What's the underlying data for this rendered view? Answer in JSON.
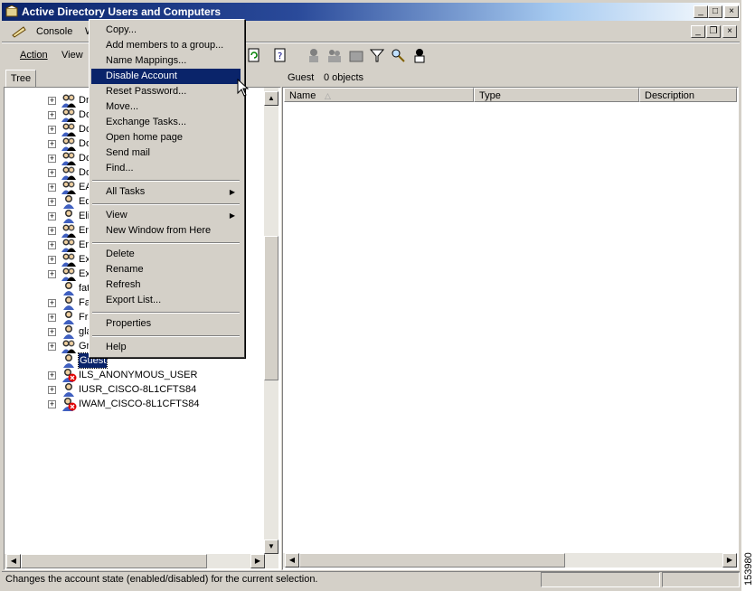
{
  "window": {
    "title": "Active Directory Users and Computers",
    "caption_buttons": {
      "minimize": "_",
      "maximize": "□",
      "close": "×"
    },
    "inner_caption_buttons": {
      "minimize": "_",
      "restore": "❐",
      "close": "×"
    }
  },
  "menubar": {
    "console": "Console",
    "window_partial": "W"
  },
  "toolbar": {
    "action": "Action",
    "view": "View"
  },
  "tree": {
    "tab": "Tree",
    "items": [
      {
        "label": "Dn",
        "icon": "user-group-icon"
      },
      {
        "label": "Do",
        "icon": "user-group-icon"
      },
      {
        "label": "Do",
        "icon": "user-group-icon"
      },
      {
        "label": "Do",
        "icon": "user-group-icon"
      },
      {
        "label": "Do",
        "icon": "user-group-icon"
      },
      {
        "label": "Do",
        "icon": "user-group-icon"
      },
      {
        "label": "EA",
        "icon": "user-group-icon"
      },
      {
        "label": "Ed",
        "icon": "user-icon"
      },
      {
        "label": "Eli",
        "icon": "user-icon"
      },
      {
        "label": "Ent",
        "icon": "user-group-icon"
      },
      {
        "label": "Ent",
        "icon": "user-group-icon"
      },
      {
        "label": "Exc",
        "icon": "user-group-icon"
      },
      {
        "label": "Exc",
        "icon": "user-group-icon"
      },
      {
        "label": "fat",
        "icon": "user-icon"
      },
      {
        "label": "Fav",
        "icon": "user-icon"
      },
      {
        "label": "Fra",
        "icon": "user-icon"
      },
      {
        "label": "gla",
        "icon": "user-icon"
      },
      {
        "label": "Gro",
        "icon": "user-group-icon"
      },
      {
        "label": "Guest",
        "icon": "user-icon",
        "selected": true
      },
      {
        "label": "ILS_ANONYMOUS_USER",
        "icon": "disabled-user-icon"
      },
      {
        "label": "IUSR_CISCO-8L1CFTS84",
        "icon": "user-icon"
      },
      {
        "label": "IWAM_CISCO-8L1CFTS84",
        "icon": "disabled-user-icon"
      }
    ]
  },
  "details": {
    "header_name": "Guest",
    "header_count": "0 objects",
    "columns": [
      "Name",
      "Type",
      "Description"
    ]
  },
  "context_menu": {
    "groups": [
      [
        "Copy...",
        "Add members to a group...",
        "Name Mappings...",
        "Disable Account",
        "Reset Password...",
        "Move...",
        "Exchange Tasks...",
        "Open home page",
        "Send mail",
        "Find..."
      ],
      [
        "All Tasks"
      ],
      [
        "View",
        "New Window from Here"
      ],
      [
        "Delete",
        "Rename",
        "Refresh",
        "Export List..."
      ],
      [
        "Properties"
      ],
      [
        "Help"
      ]
    ],
    "selected": "Disable Account",
    "submenu_items": [
      "All Tasks",
      "View"
    ]
  },
  "statusbar": {
    "text": "Changes the account state (enabled/disabled) for the current selection."
  },
  "side_label": "153980"
}
